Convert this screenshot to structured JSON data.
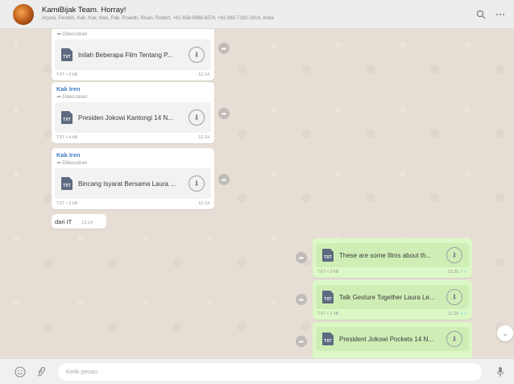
{
  "header": {
    "title": "KamiBijak Team. Horray!",
    "members": "Aryani, Fendrik, Kak, Kak, Mas, Pak, Powetti, Rivan, Robert, +62 858-9998-8274, +62 882-7182-1814, Anda",
    "search_icon": "search-icon",
    "menu_icon": "more-icon"
  },
  "incoming": [
    {
      "sender": "",
      "forwarded": "Diteruskan",
      "file_type": "TXT",
      "file_name": "Inilah Beberapa Film Tentang P...",
      "file_meta": "TXT • 3 kB",
      "time": "12.14"
    },
    {
      "sender": "Kak Iren",
      "forwarded": "Diteruskan",
      "file_type": "TXT",
      "file_name": "Presiden Jokowi Kantongi 14 N...",
      "file_meta": "TXT • 4 kB",
      "time": "12.14"
    },
    {
      "sender": "Kak Iren",
      "forwarded": "Diteruskan",
      "file_type": "TXT",
      "file_name": "Bincang Isyarat Bersama Laura ...",
      "file_meta": "TXT • 3 kB",
      "time": "12.14"
    }
  ],
  "text_message": {
    "text": "dari IT",
    "time": "12.14"
  },
  "outgoing": [
    {
      "file_type": "TXT",
      "file_name": "These are some films about th...",
      "file_meta": "TXT • 3 kB",
      "time": "12.35"
    },
    {
      "file_type": "TXT",
      "file_name": "Talk Gesture Together Laura Le...",
      "file_meta": "TXT • 2 kB",
      "time": "12.35"
    },
    {
      "file_type": "TXT",
      "file_name": "President Jokowi Pockets 14 N...",
      "file_meta": "",
      "time": ""
    }
  ],
  "footer": {
    "placeholder": "Ketik pesan",
    "emoji_icon": "emoji-icon",
    "attach_icon": "attach-icon",
    "mic_icon": "mic-icon"
  },
  "colors": {
    "incoming_bubble": "#ffffff",
    "outgoing_bubble": "#dcf8c6",
    "sender_name": "#3b7cc4",
    "read_tick": "#4fc3f7"
  }
}
